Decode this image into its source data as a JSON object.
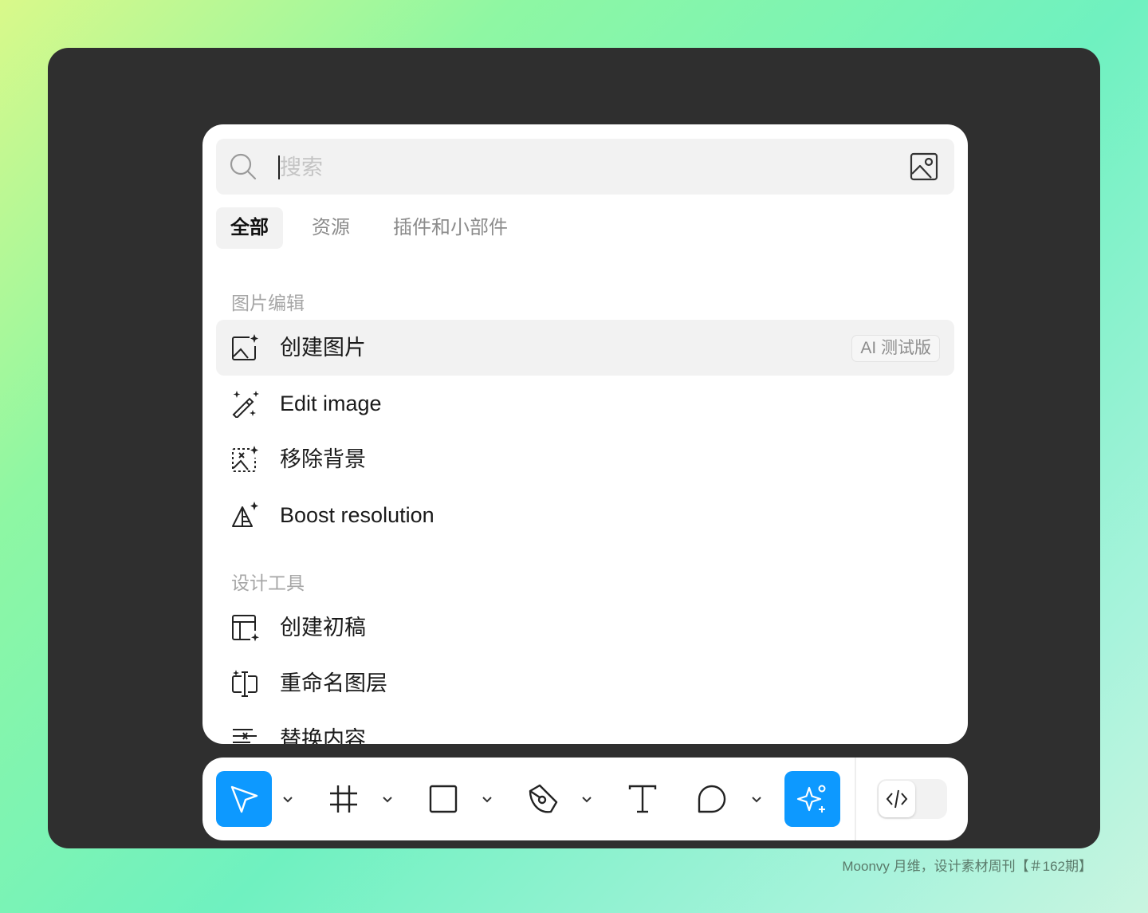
{
  "search": {
    "placeholder": "搜索"
  },
  "tabs": [
    {
      "label": "全部",
      "active": true
    },
    {
      "label": "资源",
      "active": false
    },
    {
      "label": "插件和小部件",
      "active": false
    }
  ],
  "sections": [
    {
      "title": "图片编辑",
      "items": [
        {
          "label": "创建图片",
          "icon": "image-sparkle-icon",
          "badge": "AI 测试版",
          "highlighted": true
        },
        {
          "label": "Edit image",
          "icon": "magic-wand-icon"
        },
        {
          "label": "移除背景",
          "icon": "remove-background-icon"
        },
        {
          "label": "Boost resolution",
          "icon": "boost-resolution-icon"
        }
      ]
    },
    {
      "title": "设计工具",
      "items": [
        {
          "label": "创建初稿",
          "icon": "layout-sparkle-icon"
        },
        {
          "label": "重命名图层",
          "icon": "rename-layer-icon"
        },
        {
          "label": "替换内容",
          "icon": "replace-content-icon"
        }
      ]
    }
  ],
  "toolbar": {
    "tools": [
      "move-tool",
      "frame-tool",
      "rectangle-tool",
      "pen-tool",
      "text-tool",
      "comment-tool",
      "ai-actions-tool"
    ],
    "accent": "#0d99ff"
  },
  "watermark": "Moonvy 月维，设计素材周刊【＃162期】"
}
